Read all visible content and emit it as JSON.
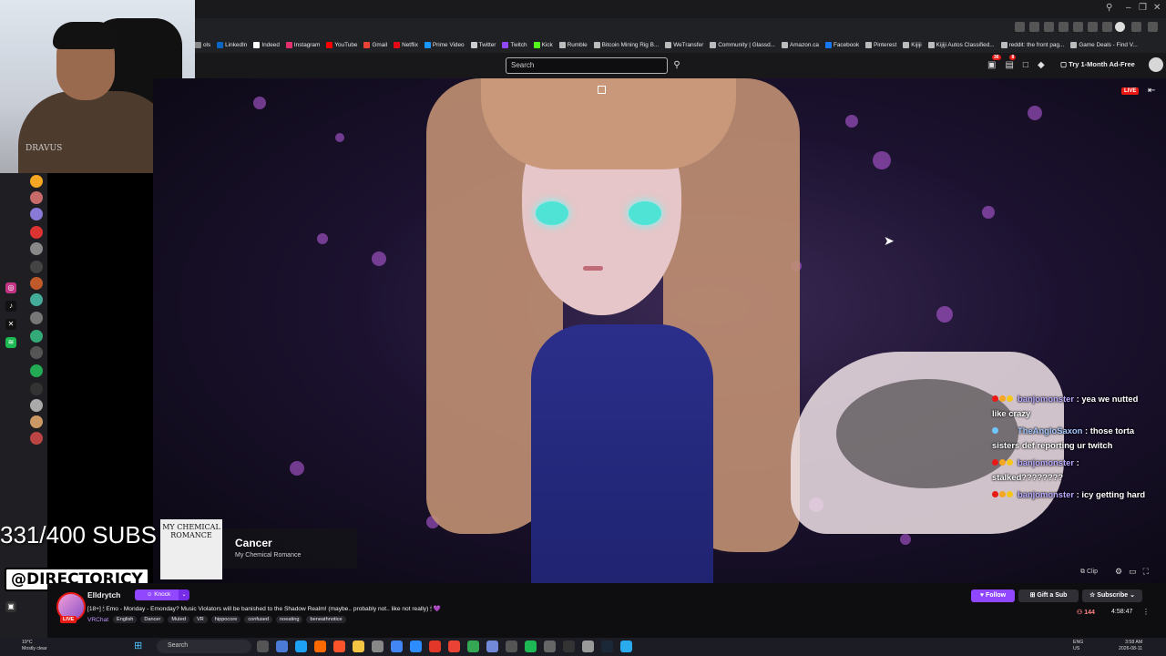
{
  "browser": {
    "bookmarks": [
      {
        "label": "ols",
        "color": "#888"
      },
      {
        "label": "LinkedIn",
        "color": "#0a66c2"
      },
      {
        "label": "Indeed",
        "color": "#ffffff"
      },
      {
        "label": "Instagram",
        "color": "#e1306c"
      },
      {
        "label": "YouTube",
        "color": "#ff0000"
      },
      {
        "label": "Gmail",
        "color": "#ea4335"
      },
      {
        "label": "Netflix",
        "color": "#e50914"
      },
      {
        "label": "Prime Video",
        "color": "#1a98ff"
      },
      {
        "label": "Twitter",
        "color": "#cccccc"
      },
      {
        "label": "Twitch",
        "color": "#9147ff"
      },
      {
        "label": "Kick",
        "color": "#53fc18"
      },
      {
        "label": "Rumble",
        "color": "#bbbbbb"
      },
      {
        "label": "Bitcoin Mining Rig B...",
        "color": "#bbbbbb"
      },
      {
        "label": "WeTransfer",
        "color": "#bbbbbb"
      },
      {
        "label": "Community | Glassd...",
        "color": "#bbbbbb"
      },
      {
        "label": "Amazon.ca",
        "color": "#bbbbbb"
      },
      {
        "label": "Facebook",
        "color": "#1877f2"
      },
      {
        "label": "Pinterest",
        "color": "#bbbbbb"
      },
      {
        "label": "Kijiji",
        "color": "#bbbbbb"
      },
      {
        "label": "Kijiji Autos Classified...",
        "color": "#bbbbbb"
      },
      {
        "label": "reddit: the front pag...",
        "color": "#bbbbbb"
      },
      {
        "label": "Game Deals - Find V...",
        "color": "#bbbbbb"
      }
    ]
  },
  "header": {
    "search_placeholder": "Search",
    "notif_badge_1": "36",
    "notif_badge_2": "8",
    "adfree_label": "Try 1-Month Ad-Free"
  },
  "webcam": {
    "shirt_text": "DRAVUS"
  },
  "player": {
    "live_label": "LIVE",
    "clip_label": "Clip"
  },
  "chat": [
    {
      "user": "banjomonster",
      "text": "yea we nutted like crazy",
      "badge_colors": [
        "#e91916",
        "#f5a623",
        "#f5c518"
      ]
    },
    {
      "user": "TheAngloSaxon",
      "text": "those torta sisters def reporting ur twitch",
      "badge_colors": [
        "#6ec6ff"
      ]
    },
    {
      "user": "banjomonster",
      "text": "stalked????????",
      "badge_colors": [
        "#e91916",
        "#f5a623",
        "#f5c518"
      ]
    },
    {
      "user": "banjomonster",
      "text": "icy getting hard",
      "badge_colors": [
        "#e91916",
        "#f5a623",
        "#f5c518"
      ]
    }
  ],
  "overlay": {
    "subs_goal": "331/400 SUBS",
    "handle": "@DIRECTORICY",
    "album_text": "MY CHEMICAL ROMANCE",
    "now_playing_title": "Cancer",
    "now_playing_artist": "My Chemical Romance"
  },
  "channel": {
    "name": "Elldrytch",
    "live_label": "LIVE",
    "knock_label": "Knock",
    "title": "[18+] 🕯 Emo - Monday - Emonday? Music Violators will be banished to the Shadow Realm! (maybe.. probably not.. like not really) 🕯 💜",
    "game": "VRChat",
    "tags": [
      "English",
      "Dancer",
      "Muted",
      "VR",
      "hippocore",
      "confused",
      "noeating",
      "beneathnotice"
    ],
    "follow_label": "Follow",
    "gift_label": "Gift a Sub",
    "subscribe_label": "Subscribe",
    "viewers": "144",
    "uptime": "4:58:47"
  },
  "taskbar": {
    "weather_temp": "19°C",
    "weather_desc": "Mostly clear",
    "search_placeholder": "Search",
    "lang": "ENG",
    "region": "US",
    "time": "3:58 AM",
    "date": "2026-08-11"
  }
}
